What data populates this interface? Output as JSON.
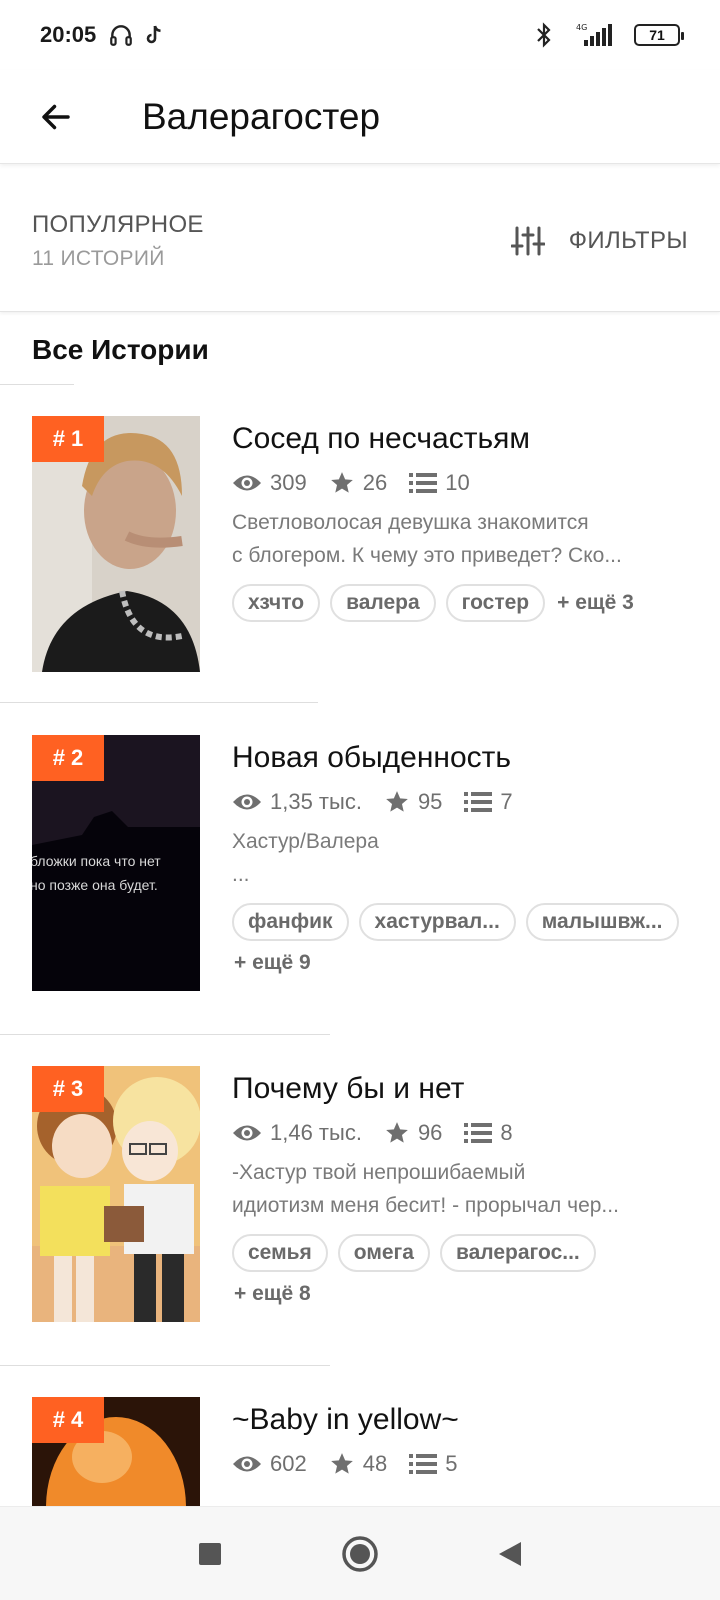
{
  "status_bar": {
    "time": "20:05",
    "battery": "71",
    "network": "4G",
    "icons": [
      "headphones-icon",
      "tiktok-icon",
      "bluetooth-icon",
      "signal-icon",
      "battery-icon"
    ]
  },
  "app_bar": {
    "title": "Валерагостер",
    "back_icon": "arrow-left-icon"
  },
  "filter_row": {
    "sort_label": "ПОПУЛЯРНОЕ",
    "count_label": "11 ИСТОРИЙ",
    "filter_label": "ФИЛЬТРЫ",
    "filter_icon": "sliders-icon"
  },
  "section_title": "Все Истории",
  "stories": [
    {
      "rank": "# 1",
      "title": "Сосед по несчастьям",
      "views": "309",
      "stars": "26",
      "parts": "10",
      "desc_lines": [
        "Светловолосая девушка знакомится",
        "с блогером. К чему это приведет? Ско..."
      ],
      "tags": [
        "хзчто",
        "валера",
        "гостер"
      ],
      "more": "+ ещё 3"
    },
    {
      "rank": "# 2",
      "title": "Новая обыденность",
      "views": "1,35 тыс.",
      "stars": "95",
      "parts": "7",
      "desc_lines": [
        "Хастур/Валера",
        "..."
      ],
      "cover_text_lines": [
        "бложки пока что нет",
        "но позже она будет."
      ],
      "tags": [
        "фанфик",
        "хастурвал...",
        "малышвж..."
      ],
      "more": "+ ещё 9"
    },
    {
      "rank": "# 3",
      "title": "Почему бы и нет",
      "views": "1,46 тыс.",
      "stars": "96",
      "parts": "8",
      "desc_lines": [
        "-Хастур твой непрошибаемый",
        "идиотизм меня бесит! - прорычал чер..."
      ],
      "tags": [
        "семья",
        "омега",
        "валерагос..."
      ],
      "more": "+ ещё 8"
    },
    {
      "rank": "# 4",
      "title": "~Baby in yellow~",
      "views": "602",
      "stars": "48",
      "parts": "5"
    }
  ],
  "colors": {
    "accent": "#ff6122",
    "text_primary": "#121212",
    "text_secondary": "#6f6f6f"
  },
  "nav_bar": {
    "icons": [
      "recents-square-icon",
      "home-circle-icon",
      "back-triangle-icon"
    ]
  }
}
